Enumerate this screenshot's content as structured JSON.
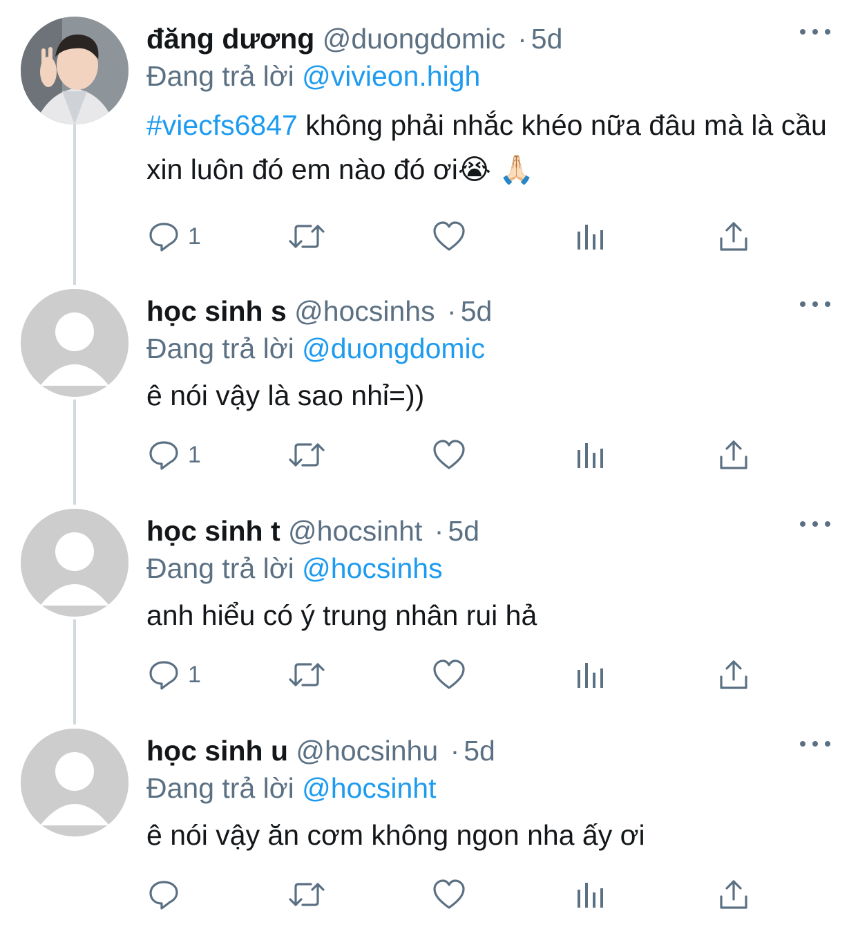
{
  "tweets": [
    {
      "name": "đăng dương",
      "handle": "@duongdomic",
      "separator": "·",
      "time": "5d",
      "reply_prefix": "Đang trả lời",
      "reply_to": "@vivieon.high",
      "hashtag": "#viecfs6847",
      "text": " không phải nhắc khéo nữa đâu mà là cầu xin luôn đó em nào đó ơi😭 🙏🏻",
      "reply_count": "1",
      "avatar": "profile-photo"
    },
    {
      "name": "học sinh s",
      "handle": "@hocsinhs",
      "separator": "·",
      "time": "5d",
      "reply_prefix": "Đang trả lời",
      "reply_to": "@duongdomic",
      "text": "ê nói vậy là sao nhỉ=))",
      "reply_count": "1",
      "avatar": "default-avatar"
    },
    {
      "name": "học sinh t",
      "handle": "@hocsinht",
      "separator": "·",
      "time": "5d",
      "reply_prefix": "Đang trả lời",
      "reply_to": "@hocsinhs",
      "text": "anh hiểu có ý trung nhân rui hả",
      "reply_count": "1",
      "avatar": "default-avatar"
    },
    {
      "name": "học sinh u",
      "handle": "@hocsinhu",
      "separator": "·",
      "time": "5d",
      "reply_prefix": "Đang trả lời",
      "reply_to": "@hocsinht",
      "text": "ê nói vậy ăn cơm không ngon nha ấy ơi",
      "reply_count": "",
      "avatar": "default-avatar"
    }
  ],
  "icons": {
    "reply": "reply-icon",
    "retweet": "retweet-icon",
    "like": "heart-icon",
    "analytics": "analytics-icon",
    "share": "share-icon",
    "more": "more-icon"
  },
  "colors": {
    "text": "#14171a",
    "secondary": "#5b7083",
    "link": "#1d9bf0",
    "thread_line": "#cfd9de",
    "default_avatar_bg": "#cdcdcd"
  }
}
